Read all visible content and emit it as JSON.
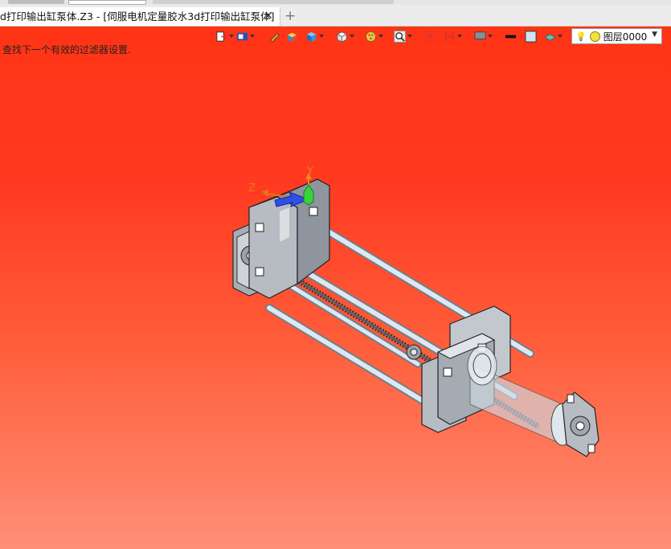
{
  "tab": {
    "title": "d打印输出缸泵体.Z3 - [伺服电机定量胶水3d打印输出缸泵体]",
    "close_glyph": "✕",
    "new_tab_glyph": "+"
  },
  "status_text": "查找下一个有效的过滤器设置.",
  "toolbar": {
    "icons": [
      "exit-icon",
      "display-icon",
      "pen-icon",
      "box-color-icon",
      "cube-blue-icon",
      "cube-white-icon",
      "color-wheel-icon",
      "zoom-icon",
      "fit-icon",
      "section-icon",
      "monitor-icon",
      "line-black-icon",
      "frame-icon",
      "layer-plane-icon"
    ]
  },
  "layer": {
    "label": "图层0000",
    "bulb_glyph": "💡",
    "dropdown_glyph": "▼"
  },
  "triad": {
    "x_label": "",
    "y_label": "Y",
    "z_label": "Z"
  },
  "colors": {
    "viewport_top": "#ff3415",
    "viewport_bottom": "#ff8f77",
    "part_gray": "#b7bcc3",
    "rod_light": "#dfe9f2",
    "axis_y": "#f08a1a",
    "axis_z": "#e07a1a",
    "axis_arrow": "#2f4fe8",
    "axis_green": "#36d33a"
  }
}
